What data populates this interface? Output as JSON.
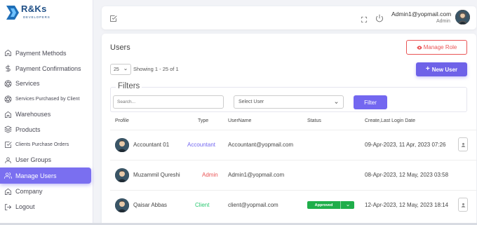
{
  "brand": {
    "name": "R&Ks",
    "tagline": "DEVELOPERS"
  },
  "sidebar": {
    "items": [
      {
        "label": "Payment Methods",
        "icon": "home-icon"
      },
      {
        "label": "Payment Confirmations",
        "icon": "dollar-icon"
      },
      {
        "label": "Services",
        "icon": "aperture-icon"
      },
      {
        "label": "Services Purchased by Client",
        "icon": "aperture-icon"
      },
      {
        "label": "Warehouses",
        "icon": "home-icon"
      },
      {
        "label": "Products",
        "icon": "layers-icon"
      },
      {
        "label": "Clients Purchase Orders",
        "icon": "check-square-icon"
      },
      {
        "label": "User Groups",
        "icon": "user-icon"
      },
      {
        "label": "Manage Users",
        "icon": "users-icon",
        "active": true
      },
      {
        "label": "Company",
        "icon": "home-icon"
      },
      {
        "label": "Logout",
        "icon": "logout-icon"
      }
    ]
  },
  "topbar": {
    "user_email": "Admin1@yopmail.com",
    "user_role": "Admin"
  },
  "main": {
    "title": "Users",
    "manage_role_label": "Manage Role",
    "new_user_label": "New User",
    "page_size": "25",
    "showing_text": "Showing 1 - 25 of 1",
    "filters": {
      "legend": "Filters",
      "search_placeholder": "Search...",
      "select_user_label": "Select User",
      "filter_button": "Filter"
    },
    "table": {
      "columns": [
        "Profile",
        "Type",
        "UserName",
        "Status",
        "Create,Last Login Date"
      ],
      "rows": [
        {
          "name": "Accountant 01",
          "type": "Accountant",
          "username": "Accountant@yopmail.com",
          "status": "",
          "dates": "09-Apr-2023, 11 Apr, 2023 07:26"
        },
        {
          "name": "Muzammil Qureshi",
          "type": "Admin",
          "username": "Admin1@yopmail.com",
          "status": "",
          "dates": "08-Apr-2023, 12 May, 2023 03:58"
        },
        {
          "name": "Qaisar Abbas",
          "type": "Client",
          "username": "client@yopmail.com",
          "status": "Approved",
          "dates": "12-Apr-2023, 12 May, 2023 18:14"
        }
      ]
    }
  },
  "colors": {
    "accent": "#7367f0",
    "danger": "#ea5455",
    "success": "#1fae4a",
    "accountant": "#7367f0",
    "admin": "#ea5455",
    "client": "#28c76f"
  }
}
